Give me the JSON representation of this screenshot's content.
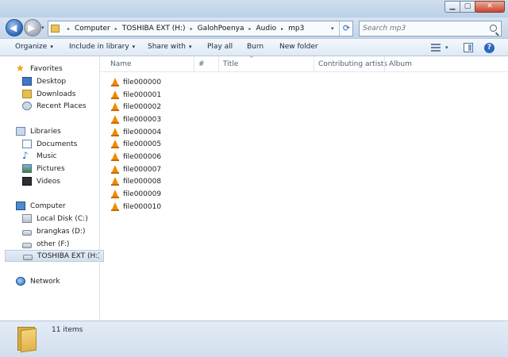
{
  "window": {
    "controls": {
      "minimize": "▁",
      "maximize": "▢",
      "close": "✕"
    }
  },
  "address_bar": {
    "crumbs": [
      "Computer",
      "TOSHIBA EXT (H:)",
      "GalohPoenya",
      "Audio",
      "mp3"
    ],
    "separator": "▸"
  },
  "search": {
    "placeholder": "Search mp3"
  },
  "toolbar": {
    "organize": "Organize",
    "include_in_library": "Include in library",
    "share_with": "Share with",
    "play_all": "Play all",
    "burn": "Burn",
    "new_folder": "New folder",
    "dropdown_arrow": "▾"
  },
  "nav": {
    "favorites": {
      "label": "Favorites",
      "items": [
        "Desktop",
        "Downloads",
        "Recent Places"
      ]
    },
    "libraries": {
      "label": "Libraries",
      "items": [
        "Documents",
        "Music",
        "Pictures",
        "Videos"
      ]
    },
    "computer": {
      "label": "Computer",
      "items": [
        "Local Disk (C:)",
        "brangkas (D:)",
        "other (F:)",
        "TOSHIBA EXT (H:)"
      ],
      "selected": "TOSHIBA EXT (H:)"
    },
    "network": {
      "label": "Network"
    }
  },
  "columns": {
    "name": "Name",
    "number": "#",
    "title": "Title",
    "contributing_artists": "Contributing artists",
    "album": "Album",
    "sort_indicator": "^"
  },
  "files": [
    "file000000",
    "file000001",
    "file000002",
    "file000003",
    "file000004",
    "file000005",
    "file000006",
    "file000007",
    "file000008",
    "file000009",
    "file000010"
  ],
  "status": {
    "item_count": "11 items"
  },
  "icons": {
    "file": "vlc-cone-icon",
    "favorites": "star-icon",
    "help": "?"
  }
}
